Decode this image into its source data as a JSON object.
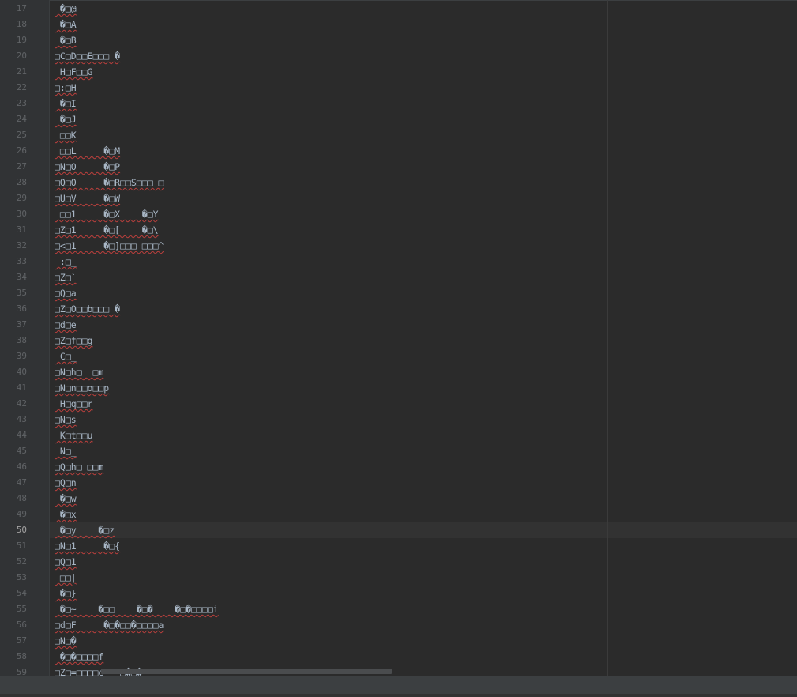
{
  "editor": {
    "current_line": "50",
    "lines": [
      {
        "n": "17",
        "text": " �\u001a@"
      },
      {
        "n": "18",
        "text": " �\u001aA"
      },
      {
        "n": "19",
        "text": " �\u001aB"
      },
      {
        "n": "20",
        "text": "\u001aC\u001aD\u001a\u001aE\u001a\u001a\u001a �"
      },
      {
        "n": "21",
        "text": " H\u001aF\u001a\u001aG"
      },
      {
        "n": "22",
        "text": "\u001a:\u001aH"
      },
      {
        "n": "23",
        "text": " �\u001aI"
      },
      {
        "n": "24",
        "text": " �\u001aJ"
      },
      {
        "n": "25",
        "text": " \u001a\u001aK"
      },
      {
        "n": "26",
        "text": " \u001a\u001aL     �\u001aM"
      },
      {
        "n": "27",
        "text": "\u001aN\u001aO     �\u001aP"
      },
      {
        "n": "28",
        "text": "\u001aQ\u001aO     �\u001aR\u001a\u001aS\u001a\u001a\u001a \u001a"
      },
      {
        "n": "29",
        "text": "\u001aU\u001aV     �\u001aW"
      },
      {
        "n": "30",
        "text": " \u001a\u001a1     �\u001aX    �\u001aY"
      },
      {
        "n": "31",
        "text": "\u001aZ\u001a1     �\u001a[    �\u001a\\"
      },
      {
        "n": "32",
        "text": "\u001a<\u001a1     �\u001a]\u001a\u001a\u001a \u001a\u001a\u001a^"
      },
      {
        "n": "33",
        "text": " :\u001a_"
      },
      {
        "n": "34",
        "text": "\u001aZ\u001a`"
      },
      {
        "n": "35",
        "text": "\u001aQ\u001aa"
      },
      {
        "n": "36",
        "text": "\u001aZ\u001aO\u001a\u001ab\u001a\u001a\u001a �"
      },
      {
        "n": "37",
        "text": "\u001ad\u001ae"
      },
      {
        "n": "38",
        "text": "\u001aZ\u001af\u001a\u001ag"
      },
      {
        "n": "39",
        "text": " C\u001a_"
      },
      {
        "n": "40",
        "text": "\u001aN\u001ah\u001a  \u001am"
      },
      {
        "n": "41",
        "text": "\u001aN\u001an\u001a\u001ao\u001a\u001ap"
      },
      {
        "n": "42",
        "text": " H\u001aq\u001a\u001ar"
      },
      {
        "n": "43",
        "text": "\u001aN\u001as"
      },
      {
        "n": "44",
        "text": " K\u001at\u001a\u001au"
      },
      {
        "n": "45",
        "text": " N\u001a_"
      },
      {
        "n": "46",
        "text": "\u001aQ\u001ah\u001a \u001a\u001am"
      },
      {
        "n": "47",
        "text": "\u001aQ\u001an"
      },
      {
        "n": "48",
        "text": " �\u001aw"
      },
      {
        "n": "49",
        "text": " �\u001ax"
      },
      {
        "n": "50",
        "text": " �\u001ay    �\u001az"
      },
      {
        "n": "51",
        "text": "\u001aN\u001a1     �\u001a{"
      },
      {
        "n": "52",
        "text": "\u001aQ\u001a1"
      },
      {
        "n": "53",
        "text": " \u001a\u001a|"
      },
      {
        "n": "54",
        "text": " �\u001a}"
      },
      {
        "n": "55",
        "text": " �\u001a~    �\u001a\u001a    �\u001a�    �\u001a�\u001a\u001a\u001a\u001ai"
      },
      {
        "n": "56",
        "text": "\u001ad\u001aF     �\u001a�\u001a\u001a�\u001a\u001a\u001a\u001aa"
      },
      {
        "n": "57",
        "text": "\u001aN\u001a�"
      },
      {
        "n": "58",
        "text": " �\u001a�\u001a\u001a\u001a\u001af"
      },
      {
        "n": "59",
        "text": "\u001aZ\u001a=\u001a\u001a\u001a\u001ae   \u001a�\u001a�"
      }
    ]
  }
}
